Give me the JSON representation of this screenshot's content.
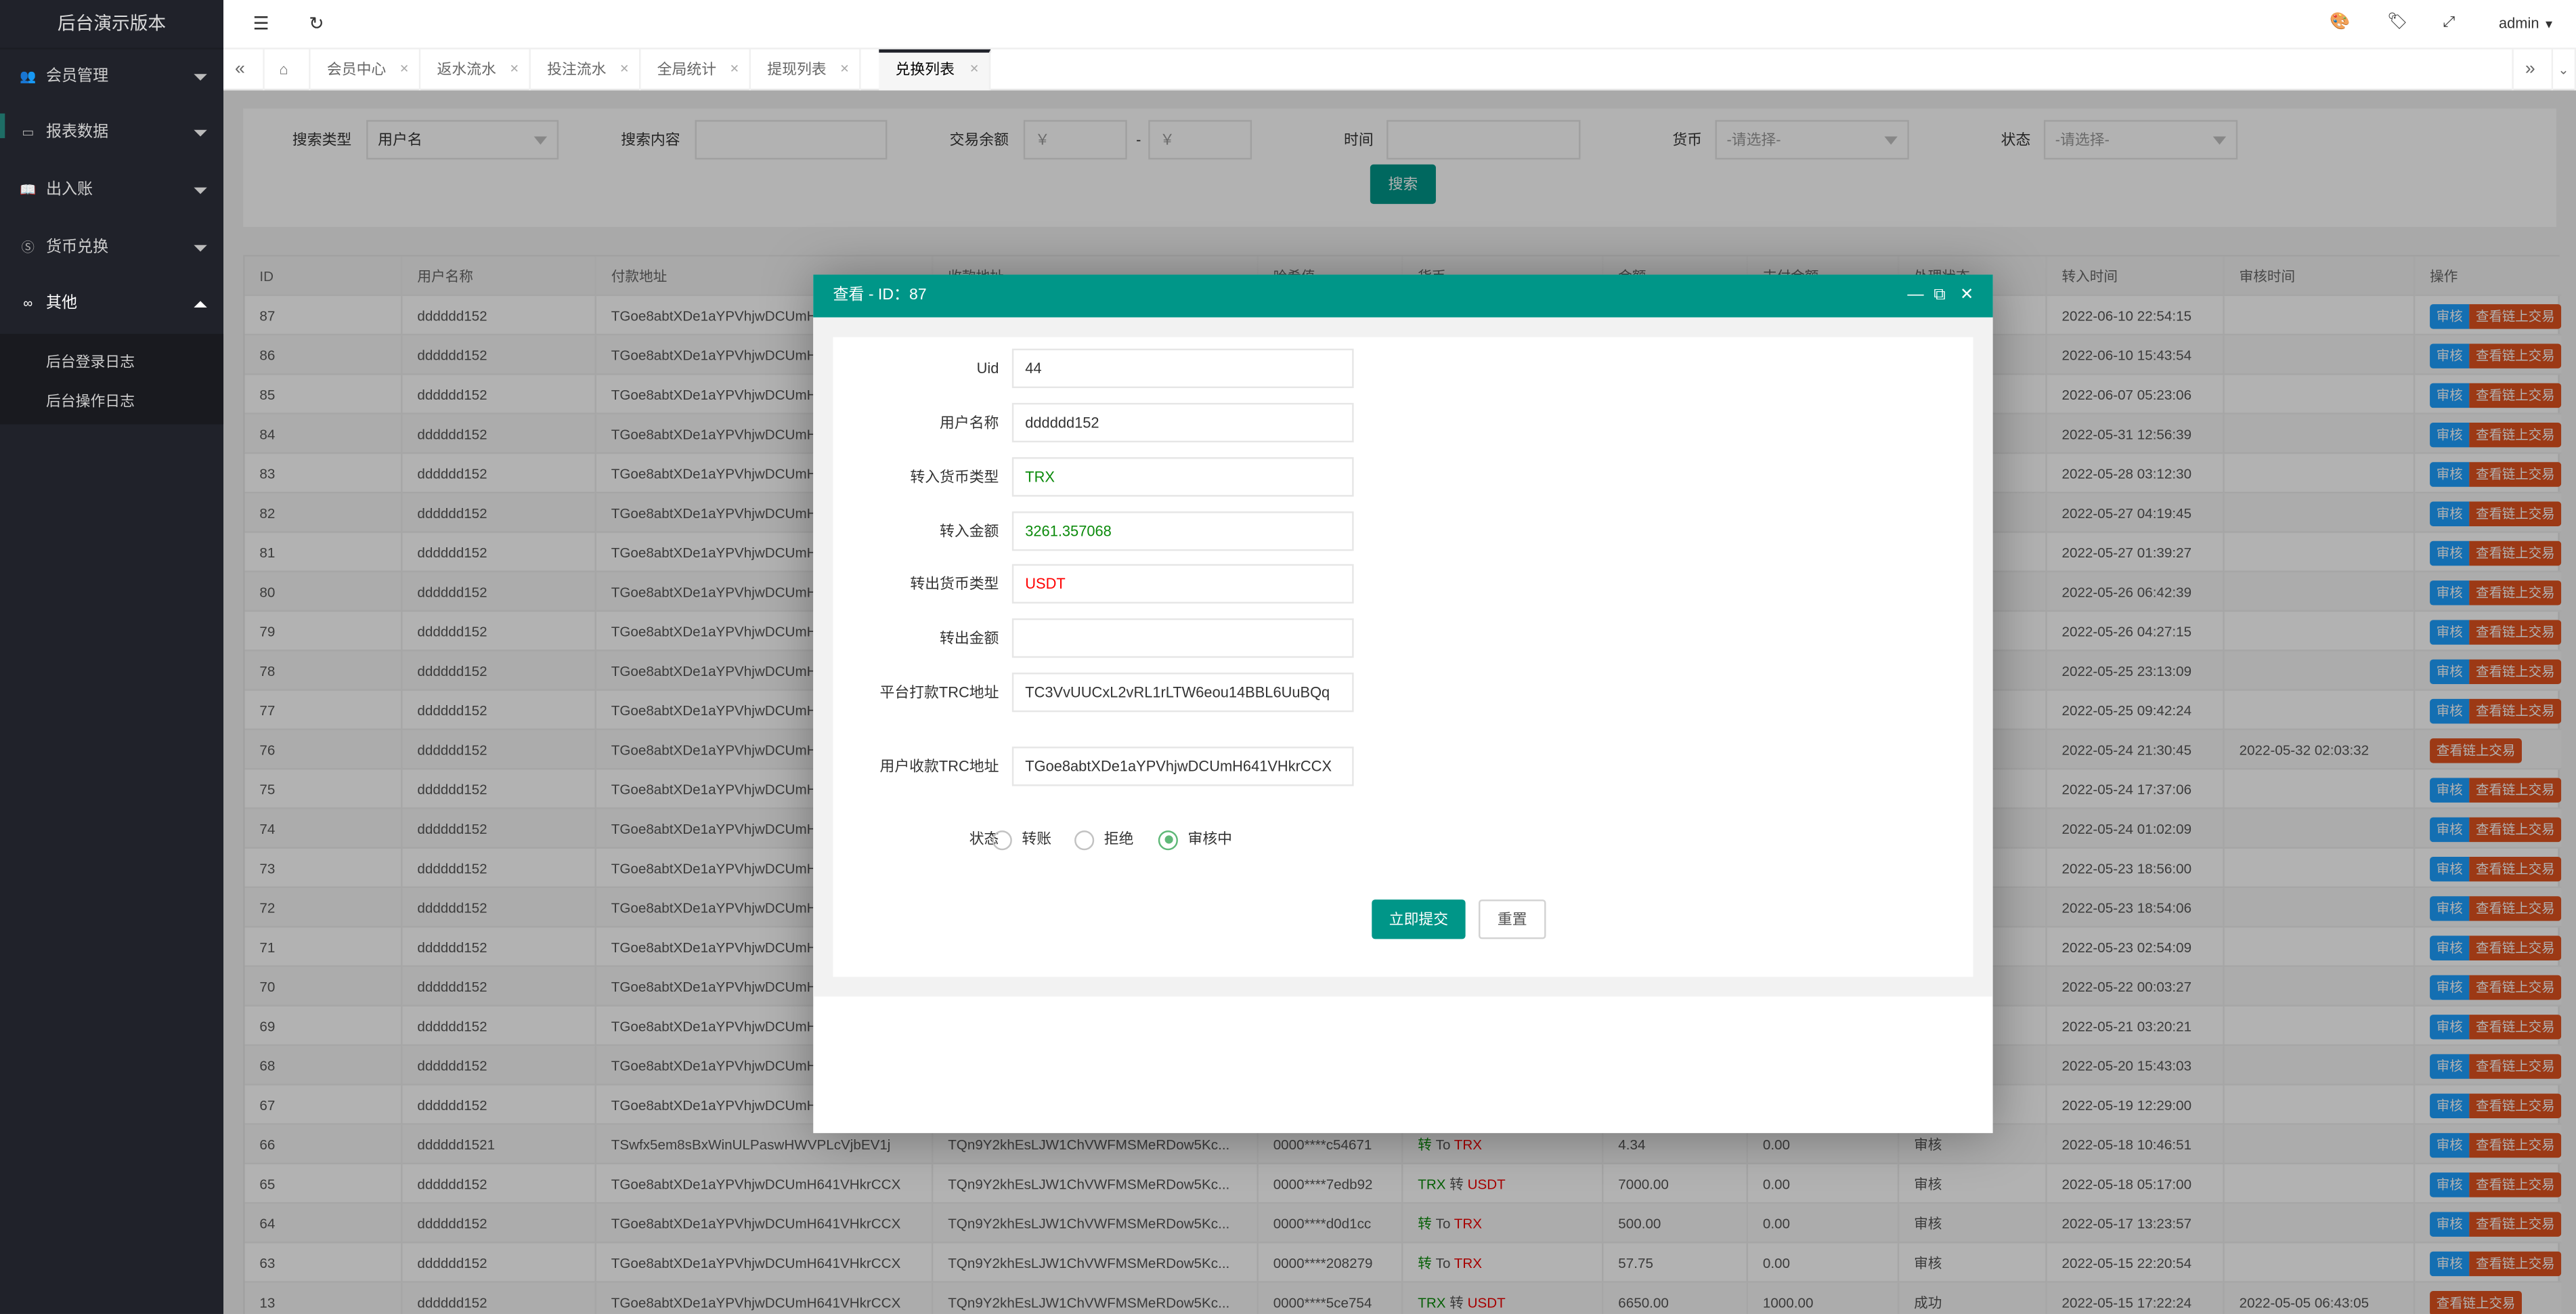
{
  "sidebar": {
    "logo": "后台演示版本",
    "items": [
      {
        "label": "会员管理",
        "icon": "users-icon",
        "expanded": false
      },
      {
        "label": "报表数据",
        "icon": "presentation-icon",
        "expanded": false
      },
      {
        "label": "出入账",
        "icon": "book-icon",
        "expanded": false
      },
      {
        "label": "货币兑换",
        "icon": "dollar-icon",
        "expanded": false
      },
      {
        "label": "其他",
        "icon": "infinity-icon",
        "expanded": true
      }
    ],
    "subitems": [
      "后台登录日志",
      "后台操作日志"
    ]
  },
  "header": {
    "user": "admin"
  },
  "tabs": [
    {
      "label": "会员中心"
    },
    {
      "label": "返水流水"
    },
    {
      "label": "投注流水"
    },
    {
      "label": "全局统计"
    },
    {
      "label": "提现列表"
    },
    {
      "label": "兑换列表",
      "active": true
    }
  ],
  "search": {
    "type_label": "搜索类型",
    "type_value": "用户名",
    "content_label": "搜索内容",
    "content_value": "",
    "amount_label": "交易余额",
    "amount_min_placeholder": "￥",
    "amount_sep": "-",
    "amount_max_placeholder": "￥",
    "time_label": "时间",
    "time_value": "",
    "currency_label": "货币",
    "currency_placeholder": "-请选择-",
    "status_label": "状态",
    "status_placeholder": "-请选择-",
    "button": "搜索"
  },
  "table": {
    "columns": [
      "ID",
      "用户名称",
      "付款地址",
      "收款地址",
      "哈希值",
      "货币",
      "金额",
      "支付金额",
      "处理状态",
      "转入时间",
      "审核时间",
      "操作"
    ],
    "audit_label": "审核",
    "chain_label": "查看链上交易",
    "rows": [
      {
        "id": "87",
        "user": "dddddd152",
        "pay": "TGoe8abtXDe1aYPVhjwDCUmH641VHkrCCX",
        "in_time": "2022-06-10 22:54:15",
        "audit_time": "",
        "audit": true
      },
      {
        "id": "86",
        "user": "dddddd152",
        "pay": "TGoe8abtXDe1aYPVhjwDCUmH641VHkrCCX",
        "in_time": "2022-06-10 15:43:54",
        "audit_time": "",
        "audit": true
      },
      {
        "id": "85",
        "user": "dddddd152",
        "pay": "TGoe8abtXDe1aYPVhjwDCUmH641VHkrCCX",
        "in_time": "2022-06-07 05:23:06",
        "audit_time": "",
        "audit": true
      },
      {
        "id": "84",
        "user": "dddddd152",
        "pay": "TGoe8abtXDe1aYPVhjwDCUmH641VHkrCCX",
        "in_time": "2022-05-31 12:56:39",
        "audit_time": "",
        "audit": true
      },
      {
        "id": "83",
        "user": "dddddd152",
        "pay": "TGoe8abtXDe1aYPVhjwDCUmH641VHkrCCX",
        "in_time": "2022-05-28 03:12:30",
        "audit_time": "",
        "audit": true
      },
      {
        "id": "82",
        "user": "dddddd152",
        "pay": "TGoe8abtXDe1aYPVhjwDCUmH641VHkrCCX",
        "in_time": "2022-05-27 04:19:45",
        "audit_time": "",
        "audit": true
      },
      {
        "id": "81",
        "user": "dddddd152",
        "pay": "TGoe8abtXDe1aYPVhjwDCUmH641VHkrCCX",
        "in_time": "2022-05-27 01:39:27",
        "audit_time": "",
        "audit": true
      },
      {
        "id": "80",
        "user": "dddddd152",
        "pay": "TGoe8abtXDe1aYPVhjwDCUmH641VHkrCCX",
        "in_time": "2022-05-26 06:42:39",
        "audit_time": "",
        "audit": true
      },
      {
        "id": "79",
        "user": "dddddd152",
        "pay": "TGoe8abtXDe1aYPVhjwDCUmH641VHkrCCX",
        "in_time": "2022-05-26 04:27:15",
        "audit_time": "",
        "audit": true
      },
      {
        "id": "78",
        "user": "dddddd152",
        "pay": "TGoe8abtXDe1aYPVhjwDCUmH641VHkrCCX",
        "in_time": "2022-05-25 23:13:09",
        "audit_time": "",
        "audit": true
      },
      {
        "id": "77",
        "user": "dddddd152",
        "pay": "TGoe8abtXDe1aYPVhjwDCUmH641VHkrCCX",
        "in_time": "2022-05-25 09:42:24",
        "audit_time": "",
        "audit": true
      },
      {
        "id": "76",
        "user": "dddddd152",
        "pay": "TGoe8abtXDe1aYPVhjwDCUmH641VHkrCCX",
        "in_time": "2022-05-24 21:30:45",
        "audit_time": "2022-05-32 02:03:32",
        "audit": false
      },
      {
        "id": "75",
        "user": "dddddd152",
        "pay": "TGoe8abtXDe1aYPVhjwDCUmH641VHkrCCX",
        "in_time": "2022-05-24 17:37:06",
        "audit_time": "",
        "audit": true
      },
      {
        "id": "74",
        "user": "dddddd152",
        "pay": "TGoe8abtXDe1aYPVhjwDCUmH641VHkrCCX",
        "in_time": "2022-05-24 01:02:09",
        "audit_time": "",
        "audit": true
      },
      {
        "id": "73",
        "user": "dddddd152",
        "pay": "TGoe8abtXDe1aYPVhjwDCUmH641VHkrCCX",
        "in_time": "2022-05-23 18:56:00",
        "audit_time": "",
        "audit": true
      },
      {
        "id": "72",
        "user": "dddddd152",
        "pay": "TGoe8abtXDe1aYPVhjwDCUmH641VHkrCCX",
        "in_time": "2022-05-23 18:54:06",
        "audit_time": "",
        "audit": true
      },
      {
        "id": "71",
        "user": "dddddd152",
        "pay": "TGoe8abtXDe1aYPVhjwDCUmH641VHkrCCX",
        "in_time": "2022-05-23 02:54:09",
        "audit_time": "",
        "audit": true
      },
      {
        "id": "70",
        "user": "dddddd152",
        "pay": "TGoe8abtXDe1aYPVhjwDCUmH641VHkrCCX",
        "in_time": "2022-05-22 00:03:27",
        "audit_time": "",
        "audit": true
      },
      {
        "id": "69",
        "user": "dddddd152",
        "pay": "TGoe8abtXDe1aYPVhjwDCUmH641VHkrCCX",
        "in_time": "2022-05-21 03:20:21",
        "audit_time": "",
        "audit": true
      },
      {
        "id": "68",
        "user": "dddddd152",
        "pay": "TGoe8abtXDe1aYPVhjwDCUmH641VHkrCCX",
        "in_time": "2022-05-20 15:43:03",
        "audit_time": "",
        "audit": true
      },
      {
        "id": "67",
        "user": "dddddd152",
        "pay": "TGoe8abtXDe1aYPVhjwDCUmH641VHkrCCX",
        "in_time": "2022-05-19 12:29:00",
        "audit_time": "",
        "audit": true
      },
      {
        "id": "66",
        "user": "dddddd1521",
        "pay": "TSwfx5em8sBxWinULPaswHWVPLcVjbEV1j",
        "recv": "TQn9Y2khEsLJW1ChVWFMSMeRDow5Kc...",
        "hash": "0000****c54671",
        "cur_from": "转",
        "cur_mid": " To ",
        "cur_to": "TRX",
        "amount": "4.34",
        "paid": "0.00",
        "status": "审核",
        "in_time": "2022-05-18 10:46:51",
        "audit_time": "",
        "audit": true
      },
      {
        "id": "65",
        "user": "dddddd152",
        "pay": "TGoe8abtXDe1aYPVhjwDCUmH641VHkrCCX",
        "recv": "TQn9Y2khEsLJW1ChVWFMSMeRDow5Kc...",
        "hash": "0000****7edb92",
        "cur_from": "TRX",
        "cur_mid": " 转 ",
        "cur_to": "USDT",
        "amount": "7000.00",
        "paid": "0.00",
        "status": "审核",
        "in_time": "2022-05-18 05:17:00",
        "audit_time": "",
        "audit": true
      },
      {
        "id": "64",
        "user": "dddddd152",
        "pay": "TGoe8abtXDe1aYPVhjwDCUmH641VHkrCCX",
        "recv": "TQn9Y2khEsLJW1ChVWFMSMeRDow5Kc...",
        "hash": "0000****d0d1cc",
        "cur_from": "转",
        "cur_mid": " To ",
        "cur_to": "TRX",
        "amount": "500.00",
        "paid": "0.00",
        "status": "审核",
        "in_time": "2022-05-17 13:23:57",
        "audit_time": "",
        "audit": true
      },
      {
        "id": "63",
        "user": "dddddd152",
        "pay": "TGoe8abtXDe1aYPVhjwDCUmH641VHkrCCX",
        "recv": "TQn9Y2khEsLJW1ChVWFMSMeRDow5Kc...",
        "hash": "0000****208279",
        "cur_from": "转",
        "cur_mid": " To ",
        "cur_to": "TRX",
        "amount": "57.75",
        "paid": "0.00",
        "status": "审核",
        "in_time": "2022-05-15 22:20:54",
        "audit_time": "",
        "audit": true
      },
      {
        "id": "13",
        "user": "dddddd152",
        "pay": "TGoe8abtXDe1aYPVhjwDCUmH641VHkrCCX",
        "recv": "TQn9Y2khEsLJW1ChVWFMSMeRDow5Kc...",
        "hash": "0000****5ce754",
        "cur_from": "TRX",
        "cur_mid": " 转 ",
        "cur_to": "USDT",
        "amount": "6650.00",
        "paid": "1000.00",
        "status": "成功",
        "in_time": "2022-05-15 17:22:24",
        "audit_time": "2022-05-05 06:43:05",
        "audit": false
      }
    ]
  },
  "modal": {
    "title": "查看 - ID：87",
    "fields": [
      {
        "label": "Uid",
        "value": "44"
      },
      {
        "label": "用户名称",
        "value": "dddddd152"
      },
      {
        "label": "转入货币类型",
        "value": "TRX",
        "color": "#0a8a0a"
      },
      {
        "label": "转入金额",
        "value": "3261.357068",
        "color": "#0a8a0a"
      },
      {
        "label": "转出货币类型",
        "value": "USDT",
        "color": "#ff0000"
      },
      {
        "label": "转出金额",
        "value": ""
      },
      {
        "label": "平台打款TRC地址",
        "value": "TC3VvUUCxL2vRL1rLTW6eou14BBL6UuBQq"
      },
      {
        "label": "用户收款TRC地址",
        "value": "TGoe8abtXDe1aYPVhjwDCUmH641VHkrCCX"
      }
    ],
    "status_label": "状态",
    "status_options": [
      "转账",
      "拒绝",
      "审核中"
    ],
    "status_selected": "审核中",
    "submit": "立即提交",
    "reset": "重置"
  },
  "colors": {
    "primary": "#009688",
    "sidebar": "#20222a",
    "audit_button": "#1e9fff",
    "chain_button": "#e0521f",
    "green": "#0a8a0a",
    "red": "#ff0000"
  }
}
